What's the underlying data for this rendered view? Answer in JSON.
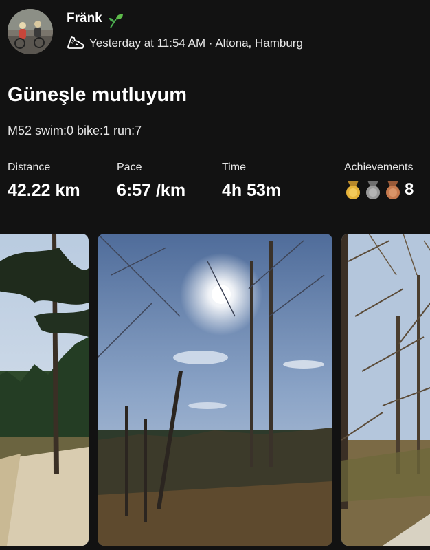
{
  "header": {
    "athlete_name": "Fränk",
    "name_emoji_icon": "sprout-icon",
    "activity_icon": "running-shoe-icon",
    "meta": "Yesterday at 11:54 AM · Altona, Hamburg"
  },
  "activity": {
    "title": "Güneşle mutluyum",
    "description": "M52 swim:0 bike:1 run:7"
  },
  "stats": {
    "distance": {
      "label": "Distance",
      "value": "42.22 km"
    },
    "pace": {
      "label": "Pace",
      "value": "6:57 /km"
    },
    "time": {
      "label": "Time",
      "value": "4h 53m"
    },
    "achievements": {
      "label": "Achievements",
      "count": "8",
      "medals": [
        {
          "icon": "gold-medal-icon",
          "color": "#e7b43a"
        },
        {
          "icon": "silver-medal-icon",
          "color": "#9a9a9a"
        },
        {
          "icon": "bronze-medal-icon",
          "color": "#c77a4e"
        }
      ]
    }
  },
  "photos": [
    {
      "name": "photo-pine-path"
    },
    {
      "name": "photo-sun-heath"
    },
    {
      "name": "photo-bare-trees"
    }
  ],
  "colors": {
    "background": "#121212",
    "text": "#ffffff",
    "sprout": "#4caf50"
  }
}
